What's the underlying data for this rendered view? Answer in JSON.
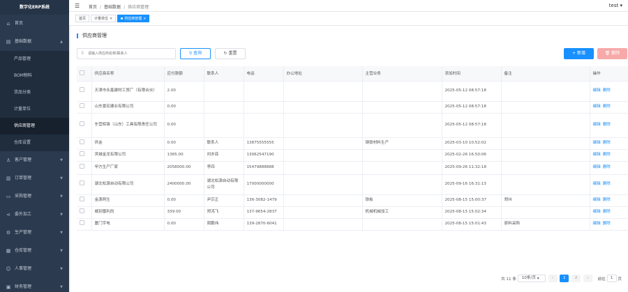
{
  "app_title": "数字化ERP系统",
  "header": {
    "breadcrumb": [
      "首页",
      "基础数据",
      "供应商管理"
    ],
    "user": "test"
  },
  "tags": [
    {
      "label": "首页",
      "active": false
    },
    {
      "label": "计量单位",
      "active": false
    },
    {
      "label": "供应商管理",
      "active": true
    }
  ],
  "sidebar": {
    "items": [
      {
        "label": "首页",
        "icon": "home-icon"
      },
      {
        "label": "基础数据",
        "icon": "document-icon",
        "expanded": true,
        "children": [
          "产品管理",
          "BOM物料",
          "货品分类",
          "计量单位",
          "供应商管理",
          "仓库设置"
        ]
      },
      {
        "label": "客户管理",
        "icon": "user-icon"
      },
      {
        "label": "订单管理",
        "icon": "order-icon"
      },
      {
        "label": "采购管理",
        "icon": "cart-icon"
      },
      {
        "label": "委外加工",
        "icon": "share-icon"
      },
      {
        "label": "生产管理",
        "icon": "settings-icon"
      },
      {
        "label": "仓库管理",
        "icon": "warehouse-icon"
      },
      {
        "label": "人事管理",
        "icon": "person-icon"
      },
      {
        "label": "财务管理",
        "icon": "finance-icon"
      }
    ],
    "active_child": "供应商管理"
  },
  "page": {
    "title": "供应商管理",
    "search_placeholder": "请输入供应商名称/联系人",
    "query_label": "查询",
    "reset_label": "重置",
    "new_label": "新增",
    "delete_label": "删除"
  },
  "table": {
    "columns": [
      "供应商名称",
      "应付款额",
      "联系人",
      "电话",
      "办公地址",
      "主营业务",
      "添加时间",
      "备注",
      "操作"
    ],
    "rows": [
      {
        "name": "天津市永鑫建材工贸厂（有限合伙）",
        "amount": "2.00",
        "contact": "",
        "phone": "",
        "address": "",
        "business": "",
        "time": "2025-05-12 08:57:18",
        "note": ""
      },
      {
        "name": "山东景宏建业有限公司",
        "amount": "0.00",
        "contact": "",
        "phone": "",
        "address": "",
        "business": "",
        "time": "2025-05-12 08:57:18",
        "note": ""
      },
      {
        "name": "东营辉锋（山东）工具有限责任公司",
        "amount": "0.00",
        "contact": "",
        "phone": "",
        "address": "",
        "business": "",
        "time": "2025-05-12 08:57:18",
        "note": ""
      },
      {
        "name": "供金",
        "amount": "0.00",
        "contact": "联系人",
        "phone": "13875555555",
        "address": "",
        "business": "钢铁材料生产",
        "time": "2025-03-10 10:52:02",
        "note": ""
      },
      {
        "name": "滨城金龙有限公司",
        "amount": "1365.00",
        "contact": "刘亦菲",
        "phone": "13062547190",
        "address": "",
        "business": "",
        "time": "2025-02-26 16:50:06",
        "note": ""
      },
      {
        "name": "甲方生产厂家",
        "amount": "2058000.00",
        "contact": "李四",
        "phone": "15479888888",
        "address": "",
        "business": "",
        "time": "2025-09-26 11:32:18",
        "note": ""
      },
      {
        "name": "湖北松源自动有限公司",
        "amount": "2400000.00",
        "contact": "湖北松源自动有限公司",
        "phone": "17000000000",
        "address": "",
        "business": "",
        "time": "2025-09-16 16:31:13",
        "note": ""
      },
      {
        "name": "金源两生",
        "amount": "0.00",
        "contact": "尹宗正",
        "phone": "136-3082-1479",
        "address": "",
        "business": "铁板",
        "time": "2025-08-15 15:00:37",
        "note": "郑州"
      },
      {
        "name": "威刻雷利尚",
        "amount": "339.00",
        "contact": "郑鸿飞",
        "phone": "137-9654-2837",
        "address": "",
        "business": "机械机械加工",
        "time": "2025-08-15 15:02:34",
        "note": ""
      },
      {
        "name": "厦门宇电",
        "amount": "0.00",
        "contact": "周鹏伟",
        "phone": "139-2870-6041",
        "address": "",
        "business": "",
        "time": "2025-08-15 15:01:43",
        "note": "原料采购"
      }
    ],
    "ops": [
      "编辑",
      "删除"
    ]
  },
  "pagination": {
    "total_text": "共 11 条",
    "page_size": "10条/页",
    "pages": [
      "1",
      "2"
    ],
    "current": "1",
    "goto_label": "前往",
    "goto_value": "1",
    "page_suffix": "页"
  },
  "colors": {
    "sidebar": "#2b3a4f",
    "accent": "#1890ff",
    "danger": "#f7a9a9"
  }
}
